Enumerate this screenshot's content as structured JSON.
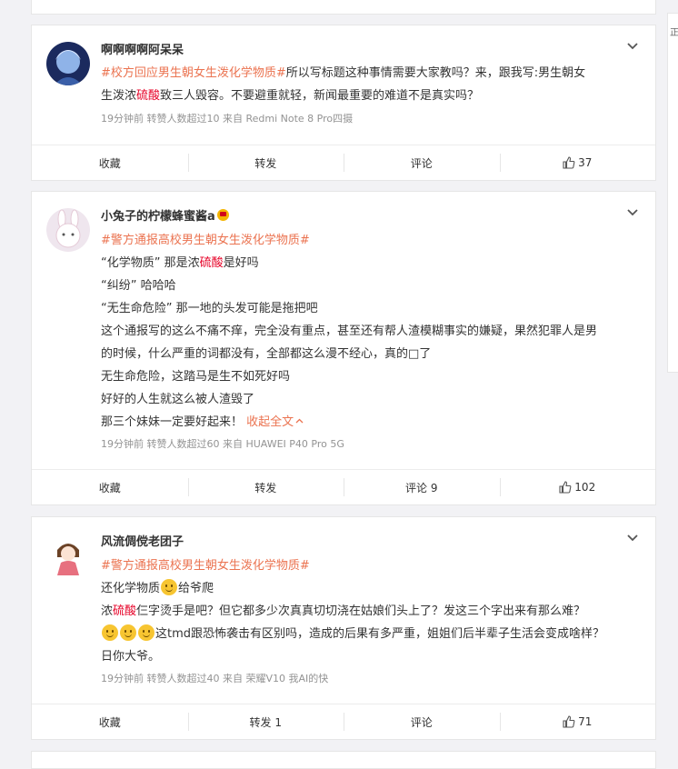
{
  "sidebar_char": "正",
  "posts": [
    {
      "username": "啊啊啊啊阿呆呆",
      "lines": [
        [
          {
            "t": "#校方回应男生朝女生泼化学物质#",
            "c": "tag"
          },
          {
            "t": "所以写标题这种事情需要大家教吗？来，跟我写:男生朝女"
          }
        ],
        [
          {
            "t": "生泼浓"
          },
          {
            "t": "硫酸",
            "c": "hl"
          },
          {
            "t": "致三人毁容。不要避重就轻，新闻最重要的难道不是真实吗？"
          }
        ]
      ],
      "meta": "19分钟前 转赞人数超过10 来自 Redmi Note 8 Pro四摄",
      "actions": {
        "fav": "收藏",
        "repost": "转发",
        "comment": "评论",
        "like": "37"
      }
    },
    {
      "username": "小兔子的柠檬蜂蜜酱a",
      "lines": [
        [
          {
            "t": "#警方通报高校男生朝女生泼化学物质#",
            "c": "tag"
          }
        ],
        [
          {
            "t": "“化学物质” 那是浓"
          },
          {
            "t": "硫酸",
            "c": "hl"
          },
          {
            "t": "是好吗"
          }
        ],
        [
          {
            "t": "“纠纷” 哈哈哈"
          }
        ],
        [
          {
            "t": "“无生命危险” 那一地的头发可能是拖把吧"
          }
        ],
        [
          {
            "t": "这个通报写的这么不痛不痒，完全没有重点，甚至还有帮人渣模糊事实的嫌疑，果然犯罪人是男"
          }
        ],
        [
          {
            "t": "的时候，什么严重的词都没有，全部都这么漫不经心，真的□了"
          }
        ],
        [
          {
            "t": "无生命危险，这踏马是生不如死好吗"
          }
        ],
        [
          {
            "t": "好好的人生就这么被人渣毁了"
          }
        ],
        [
          {
            "t": "那三个妹妹一定要好起来！ "
          },
          {
            "t": "收起全文",
            "c": "link"
          }
        ]
      ],
      "meta": "19分钟前 转赞人数超过60 来自 HUAWEI P40 Pro 5G",
      "actions": {
        "fav": "收藏",
        "repost": "转发",
        "comment": "评论 9",
        "like": "102"
      }
    },
    {
      "username": "风流倜傥老团子",
      "lines": [
        [
          {
            "t": "#警方通报高校男生朝女生泼化学物质#",
            "c": "tag"
          }
        ],
        [
          {
            "t": "还化学物质"
          },
          {
            "e": "smile"
          },
          {
            "t": "给爷爬"
          }
        ],
        [
          {
            "t": "浓"
          },
          {
            "t": "硫酸",
            "c": "hl"
          },
          {
            "t": "仨字烫手是吧？但它都多少次真真切切浇在姑娘们头上了？发这三个字出来有那么难？"
          }
        ],
        [
          {
            "e": "smile"
          },
          {
            "e": "smile"
          },
          {
            "e": "smile"
          },
          {
            "t": "这tmd跟恐怖袭击有区别吗，造成的后果有多严重，姐姐们后半辈子生活会变成啥样？"
          }
        ],
        [
          {
            "t": "日你大爷。"
          }
        ]
      ],
      "meta": "19分钟前 转赞人数超过40 来自 荣耀V10 我AI的快",
      "actions": {
        "fav": "收藏",
        "repost": "转发 1",
        "comment": "评论",
        "like": "71"
      }
    }
  ]
}
